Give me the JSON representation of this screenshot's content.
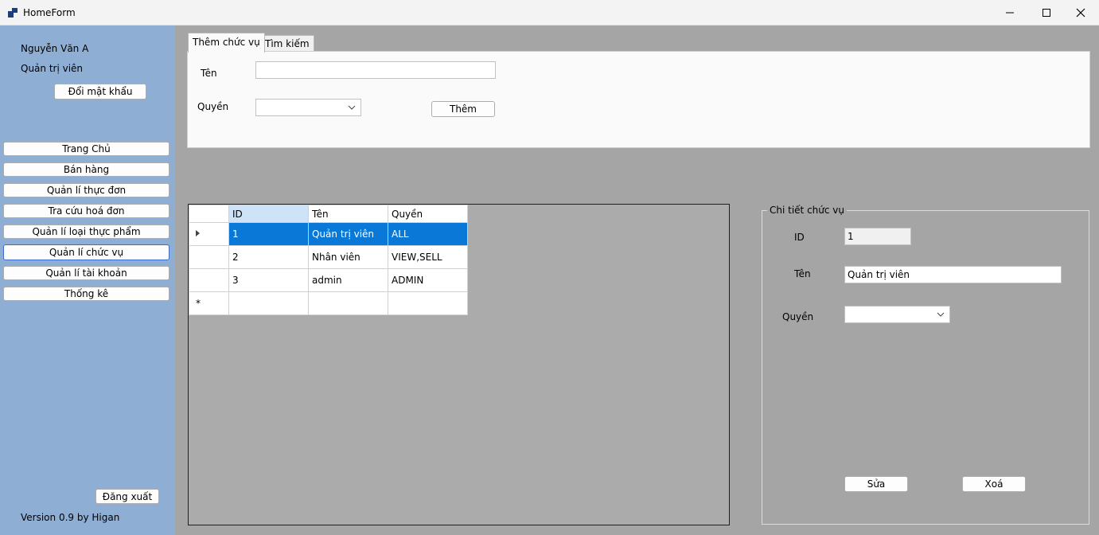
{
  "window": {
    "title": "HomeForm"
  },
  "sidebar": {
    "user_name": "Nguyễn Văn A",
    "user_role": "Quản trị viên",
    "change_password": "Đổi mật khẩu",
    "nav": [
      "Trang Chủ",
      "Bán hàng",
      "Quản lí thực đơn",
      "Tra cứu hoá đơn",
      "Quản lí loại thực phẩm",
      "Quản lí chức vụ",
      "Quản lí tài khoản",
      "Thống kê"
    ],
    "active_nav": "Quản lí chức vụ",
    "logout": "Đăng xuất",
    "version": "Version 0.9 by Higan"
  },
  "tabs": [
    "Thêm chức vụ",
    "Tìm kiếm"
  ],
  "add_form": {
    "name_label": "Tên",
    "name_value": "",
    "permission_label": "Quyền",
    "permission_value": "",
    "add_button": "Thêm"
  },
  "grid": {
    "columns": [
      "ID",
      "Tên",
      "Quyền"
    ],
    "rows": [
      [
        "1",
        "Quản trị viên",
        "ALL"
      ],
      [
        "2",
        "Nhân viên",
        "VIEW,SELL"
      ],
      [
        "3",
        "admin",
        "ADMIN"
      ]
    ],
    "selected_row": 0,
    "new_row_marker": "*"
  },
  "detail": {
    "title": "Chi tiết chức vụ",
    "id_label": "ID",
    "id_value": "1",
    "name_label": "Tên",
    "name_value": "Quản trị viên",
    "permission_label": "Quyền",
    "permission_value": "",
    "edit_button": "Sửa",
    "delete_button": "Xoá"
  },
  "colors": {
    "sidebar_bg": "#8faed4",
    "content_bg": "#a5a5a5",
    "selection": "#0a78d7"
  }
}
